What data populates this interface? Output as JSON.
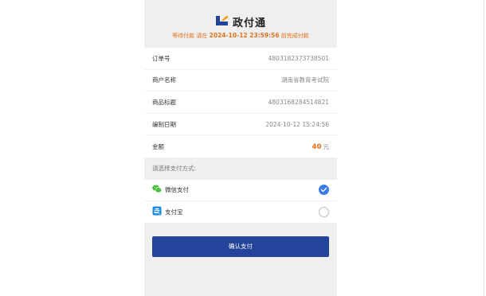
{
  "header": {
    "brand_name": "政付通",
    "status_label": "等待付款",
    "before_deadline": "请在",
    "deadline": "2024-10-12 23:59:56",
    "after_deadline": "前完成付款"
  },
  "order": {
    "rows": [
      {
        "label": "订单号",
        "value": "4803182373738501"
      },
      {
        "label": "商户名称",
        "value": "湖南省教育考试院"
      },
      {
        "label": "商品标题",
        "value": "4803168284514821"
      },
      {
        "label": "编制日期",
        "value": "2024-10-12 15:24:56"
      }
    ],
    "amount_label": "金额",
    "amount_value": "40",
    "amount_unit": "元"
  },
  "payment": {
    "section_title": "请选择支付方式:",
    "methods": [
      {
        "label": "微信支付",
        "icon": "wechat-icon",
        "selected": true
      },
      {
        "label": "支付宝",
        "icon": "alipay-icon",
        "selected": false
      }
    ]
  },
  "actions": {
    "confirm_label": "确认支付"
  },
  "colors": {
    "accent_orange": "#e4731e",
    "primary_blue": "#24449c",
    "check_blue": "#3b7ce8",
    "wechat_green": "#3fbc36",
    "alipay_blue": "#1a8ce0"
  }
}
